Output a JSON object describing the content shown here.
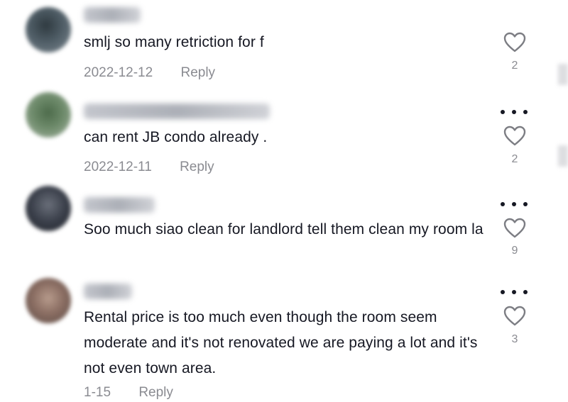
{
  "comments": [
    {
      "text": "smlj so many retriction for f",
      "date": "2022-12-12",
      "reply_label": "Reply",
      "likes": "2",
      "show_more": false,
      "avatar_color": "#4f5d66"
    },
    {
      "text": "can rent JB condo already .",
      "date": "2022-12-11",
      "reply_label": "Reply",
      "likes": "2",
      "show_more": true,
      "avatar_color": "#6d8a6a"
    },
    {
      "text": "Soo much siao clean for landlord tell them clean my room la",
      "date": "",
      "reply_label": "",
      "likes": "9",
      "show_more": true,
      "avatar_color": "#3a3f4a"
    },
    {
      "text": "Rental price is too much even though the room seem moderate and it's not renovated we are paying a lot and it's not even town area.",
      "date": "1-15",
      "reply_label": "Reply",
      "likes": "3",
      "show_more": true,
      "avatar_color": "#8b6e63"
    }
  ],
  "icons": {
    "like": "heart-outline-icon",
    "more": "more-options-icon"
  }
}
